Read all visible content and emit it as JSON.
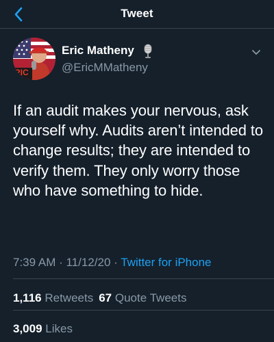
{
  "header": {
    "title": "Tweet",
    "back_icon": "chevron-left-icon"
  },
  "author": {
    "name": "Eric Matheny",
    "handle": "@EricMMatheny",
    "badge_icon": "microphone-icon",
    "avatar_text": "RIC"
  },
  "tweet": {
    "text": "If an audit makes your nervous, ask yourself why. Audits aren’t intended to change results; they are intended to verify them. They only worry those who have something to hide."
  },
  "meta": {
    "time": "7:39 AM",
    "sep1": " · ",
    "date": "11/12/20",
    "sep2": " · ",
    "source": "Twitter for iPhone"
  },
  "stats": {
    "retweets_count": "1,116",
    "retweets_label": "Retweets",
    "quotes_count": "67",
    "quotes_label": "Quote Tweets",
    "likes_count": "3,009",
    "likes_label": "Likes"
  },
  "colors": {
    "background": "#15202b",
    "accent": "#1da1f2",
    "secondary_text": "#8899a6",
    "divider": "#38444d"
  }
}
